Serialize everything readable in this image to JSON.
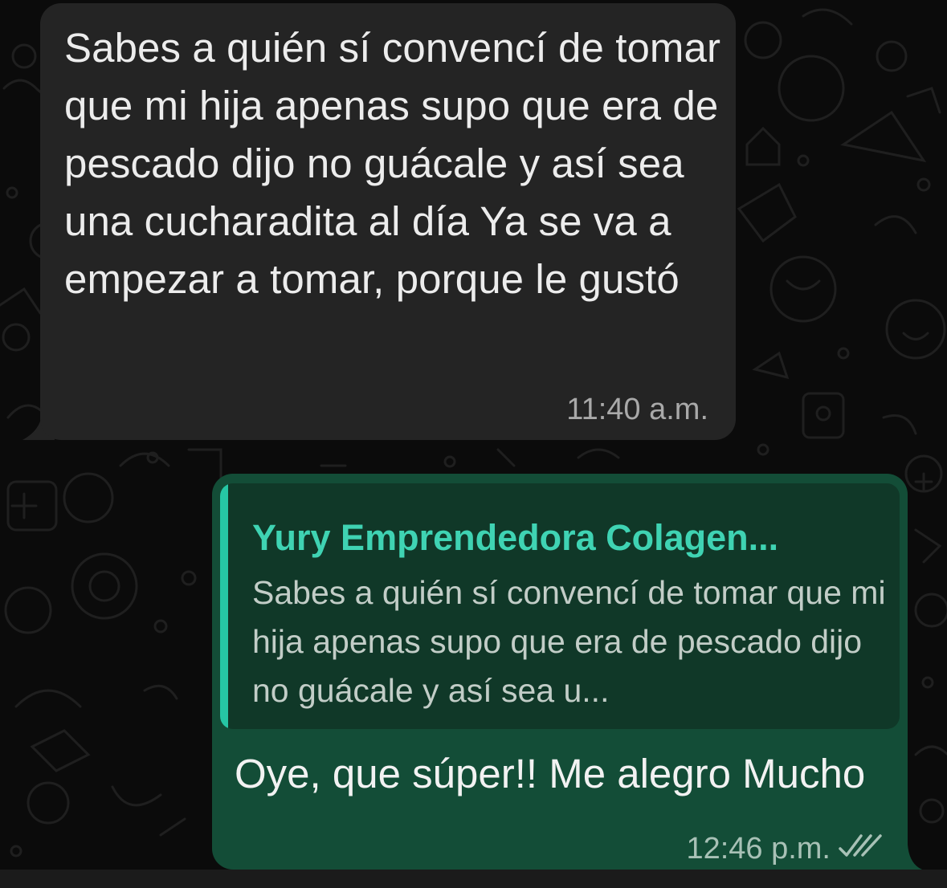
{
  "colors": {
    "background": "#0b0b0b",
    "incoming_bubble": "#242424",
    "outgoing_bubble": "#134d37",
    "quote_background": "#103828",
    "quote_accent": "#26c6a4",
    "quote_author": "#3fd3b3",
    "doodle_stroke": "#1f1f1f"
  },
  "messages": {
    "incoming": {
      "text": "Sabes a quién sí convencí de tomar que mi hija apenas supo que era de pescado dijo no guácale y así sea una cucharadita al día Ya se va a empezar a tomar, porque le gustó",
      "time": "11:40 a.m."
    },
    "outgoing": {
      "quote_author": "Yury Emprendedora Colagen...",
      "quote_text": "Sabes a quién sí convencí de tomar que mi hija apenas supo que era de pescado dijo no guácale y así sea u...",
      "text": "Oye, que súper!! Me alegro Mucho",
      "time": "12:46 p.m.",
      "status_icon": "double-check-read-icon"
    }
  }
}
